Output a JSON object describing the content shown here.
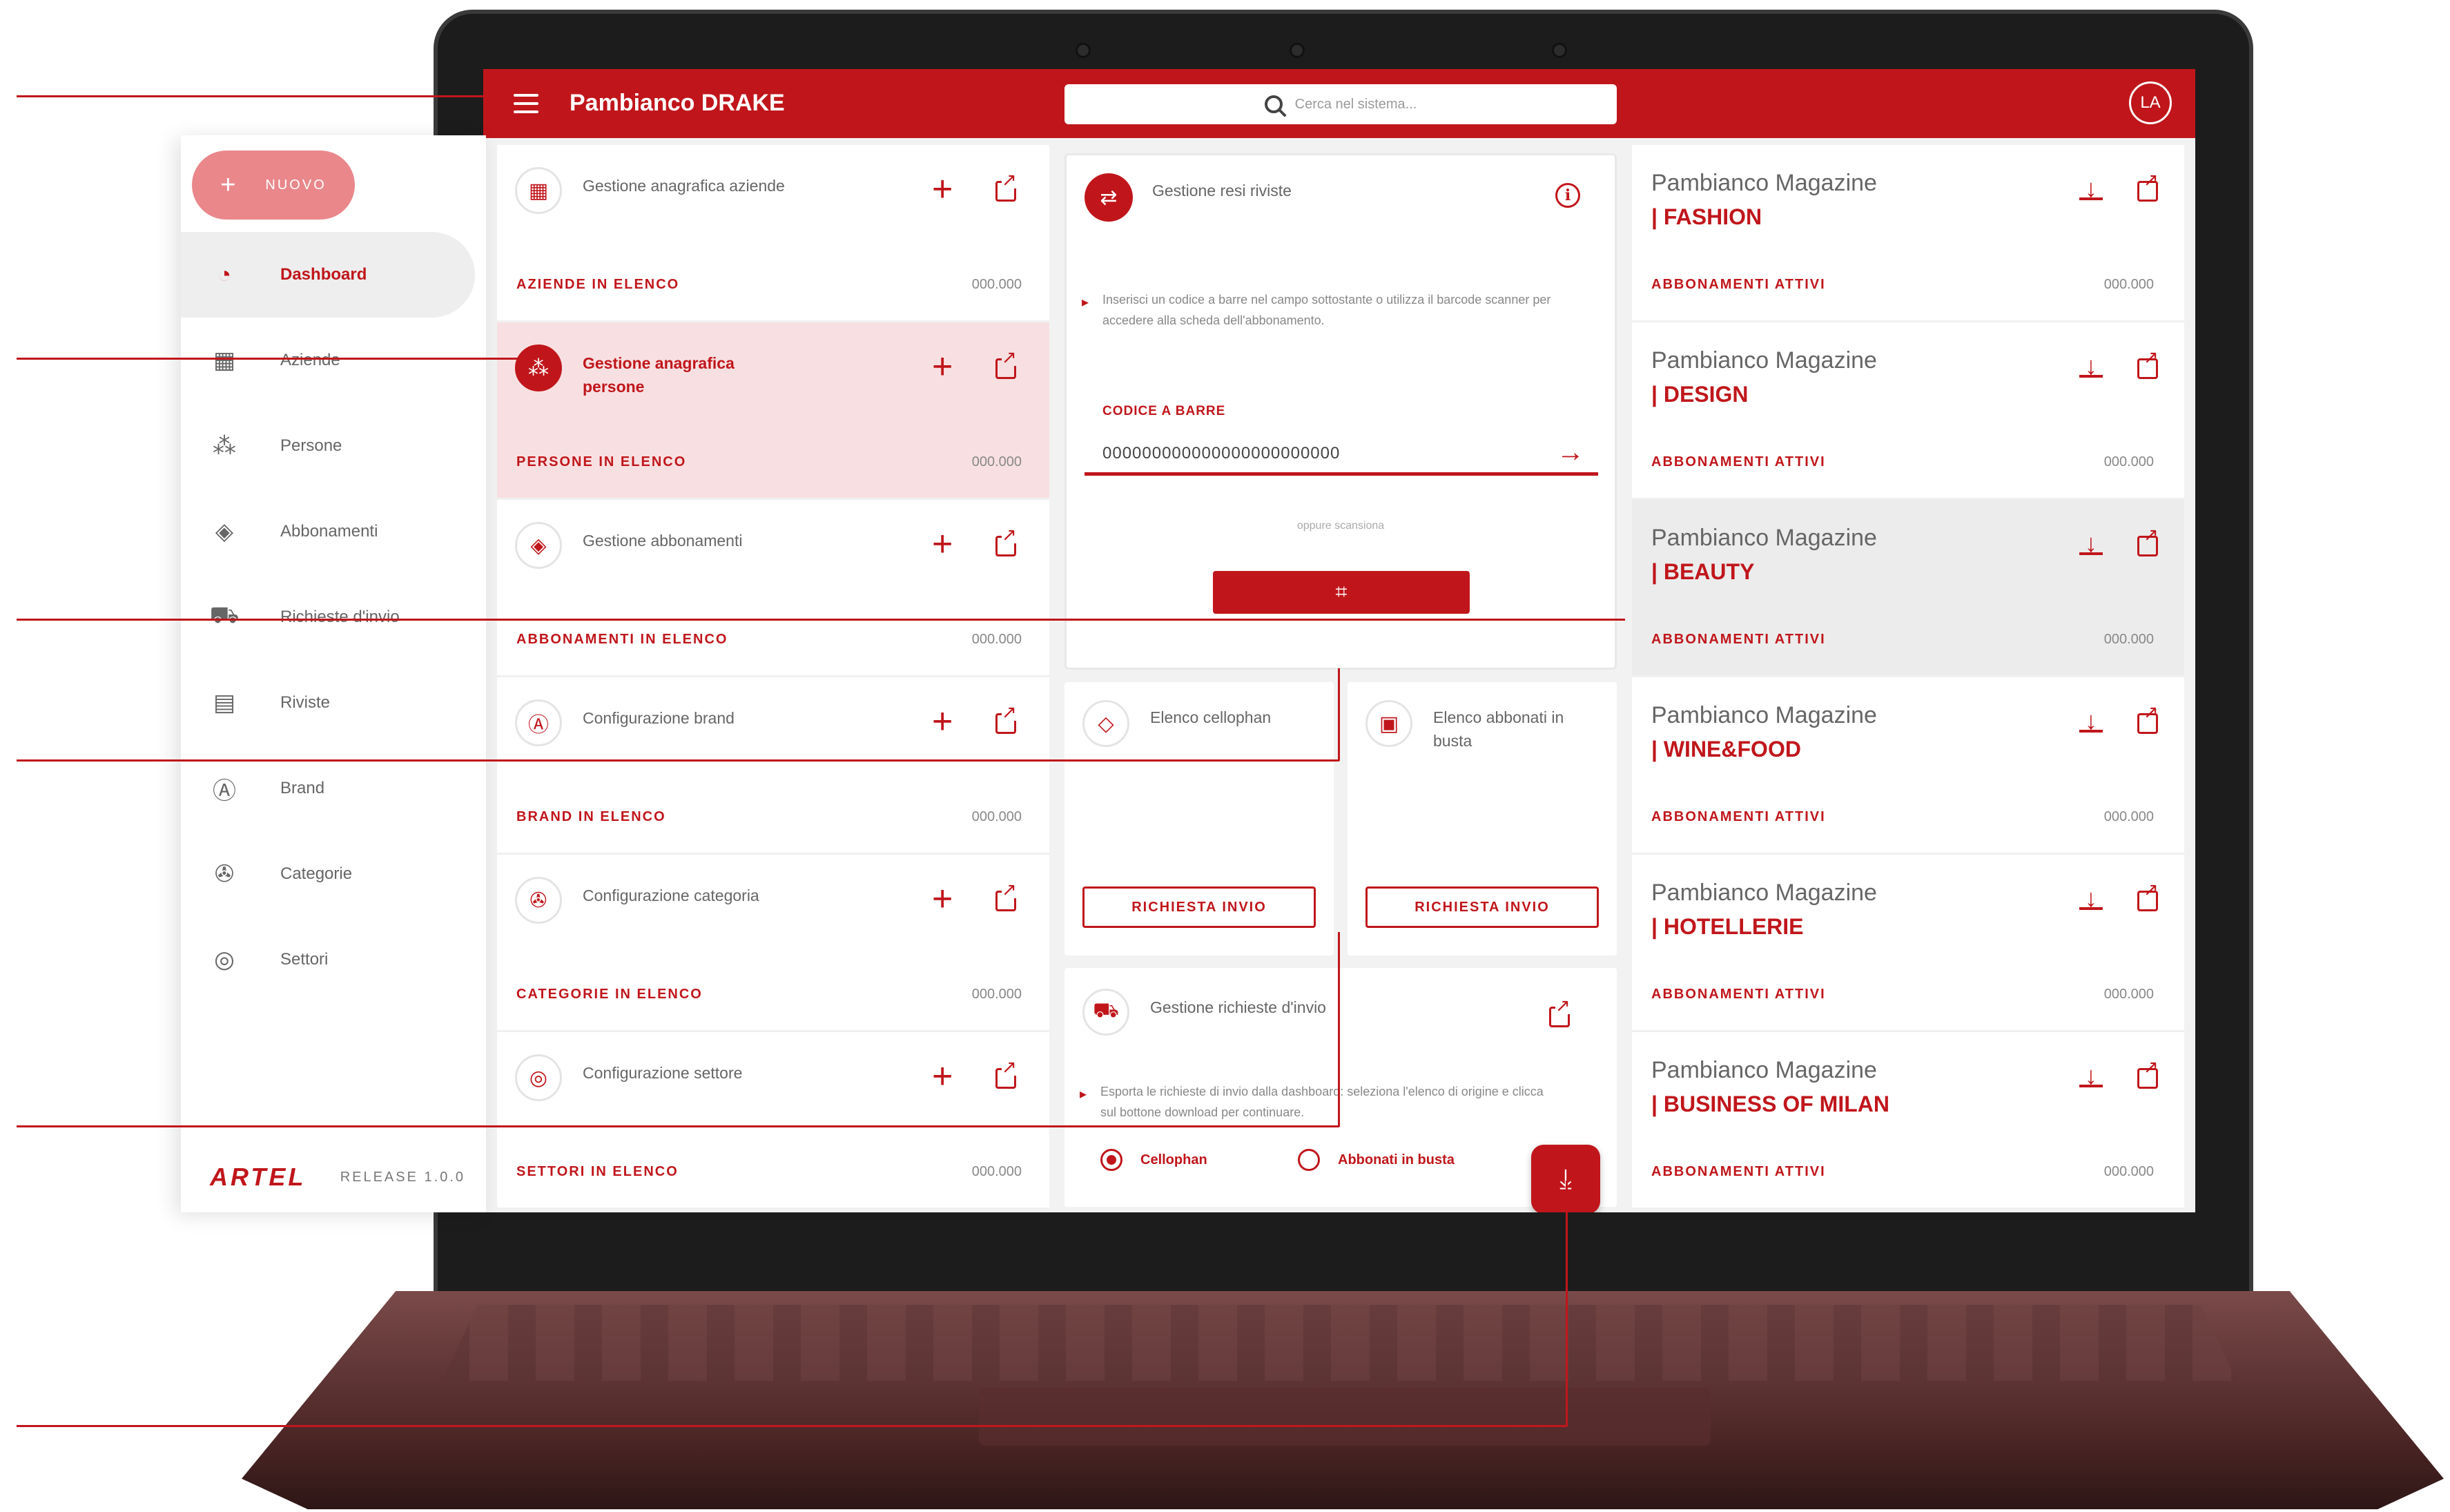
{
  "app": {
    "title": "Pambianco DRAKE",
    "search_placeholder": "Cerca nel sistema...",
    "user_initials": "LA"
  },
  "sidebar": {
    "new_button_label": "NUOVO",
    "items": [
      {
        "label": "Dashboard",
        "icon": "speedometer-icon",
        "glyph": "◔",
        "active": true
      },
      {
        "label": "Aziende",
        "icon": "building-icon",
        "glyph": "▦",
        "active": false
      },
      {
        "label": "Persone",
        "icon": "people-icon",
        "glyph": "⁂",
        "active": false
      },
      {
        "label": "Abbonamenti",
        "icon": "subscription-icon",
        "glyph": "◈",
        "active": false
      },
      {
        "label": "Richieste d'invio",
        "icon": "truck-icon",
        "glyph": "⛟",
        "active": false
      },
      {
        "label": "Riviste",
        "icon": "magazine-icon",
        "glyph": "▤",
        "active": false
      },
      {
        "label": "Brand",
        "icon": "brand-icon",
        "glyph": "Ⓐ",
        "active": false
      },
      {
        "label": "Categorie",
        "icon": "category-icon",
        "glyph": "✇",
        "active": false
      },
      {
        "label": "Settori",
        "icon": "sector-icon",
        "glyph": "◎",
        "active": false
      }
    ],
    "logo_text": "ARTEL",
    "release": "RELEASE 1.0.0"
  },
  "management_cards": [
    {
      "title": "Gestione anagrafica aziende",
      "footer_label": "AZIENDE IN ELENCO",
      "count": "000.000",
      "icon": "building-icon",
      "glyph": "▦",
      "active": false
    },
    {
      "title": "Gestione anagrafica persone",
      "footer_label": "PERSONE IN ELENCO",
      "count": "000.000",
      "icon": "people-icon",
      "glyph": "⁂",
      "active": true
    },
    {
      "title": "Gestione abbonamenti",
      "footer_label": "ABBONAMENTI IN ELENCO",
      "count": "000.000",
      "icon": "subscription-icon",
      "glyph": "◈",
      "active": false
    },
    {
      "title": "Configurazione brand",
      "footer_label": "BRAND IN ELENCO",
      "count": "000.000",
      "icon": "brand-icon",
      "glyph": "Ⓐ",
      "active": false
    },
    {
      "title": "Configurazione categoria",
      "footer_label": "CATEGORIE IN ELENCO",
      "count": "000.000",
      "icon": "category-icon",
      "glyph": "✇",
      "active": false
    },
    {
      "title": "Configurazione settore",
      "footer_label": "SETTORI IN ELENCO",
      "count": "000.000",
      "icon": "sector-icon",
      "glyph": "◎",
      "active": false
    }
  ],
  "resi": {
    "title": "Gestione resi riviste",
    "instructions": "Inserisci un codice a barre nel campo sottostante o utilizza il barcode scanner per accedere alla scheda dell'abbonamento.",
    "code_label": "CODICE A BARRE",
    "code_value": "000000000000000000000000",
    "or_scan": "oppure scansiona"
  },
  "elenco_cards": [
    {
      "title": "Elenco cellophan",
      "button": "RICHIESTA INVIO",
      "icon": "tag-icon",
      "glyph": "◇"
    },
    {
      "title": "Elenco abbonati in busta",
      "button": "RICHIESTA INVIO",
      "icon": "envelope-icon",
      "glyph": "▣"
    }
  ],
  "richieste": {
    "title": "Gestione richieste d'invio",
    "instructions": "Esporta le richieste di invio dalla dashboard: seleziona l'elenco di origine e clicca sul bottone download per continuare.",
    "options": [
      {
        "label": "Cellophan",
        "selected": true
      },
      {
        "label": "Abbonati in busta",
        "selected": false
      }
    ]
  },
  "magazines": [
    {
      "name": "Pambianco Magazine",
      "sub": "| FASHION",
      "footer_label": "ABBONAMENTI ATTIVI",
      "count": "000.000",
      "highlight": false
    },
    {
      "name": "Pambianco Magazine",
      "sub": "| DESIGN",
      "footer_label": "ABBONAMENTI ATTIVI",
      "count": "000.000",
      "highlight": false
    },
    {
      "name": "Pambianco Magazine",
      "sub": "| BEAUTY",
      "footer_label": "ABBONAMENTI ATTIVI",
      "count": "000.000",
      "highlight": true
    },
    {
      "name": "Pambianco Magazine",
      "sub": "| WINE&FOOD",
      "footer_label": "ABBONAMENTI ATTIVI",
      "count": "000.000",
      "highlight": false
    },
    {
      "name": "Pambianco Magazine",
      "sub": "| HOTELLERIE",
      "footer_label": "ABBONAMENTI ATTIVI",
      "count": "000.000",
      "highlight": false
    },
    {
      "name": "Pambianco Magazine",
      "sub": "| BUSINESS OF MILAN",
      "footer_label": "ABBONAMENTI ATTIVI",
      "count": "000.000",
      "highlight": false
    }
  ],
  "colors": {
    "accent": "#c0161b",
    "accent_light": "#f8e0e2",
    "background": "#f2f2f2"
  }
}
